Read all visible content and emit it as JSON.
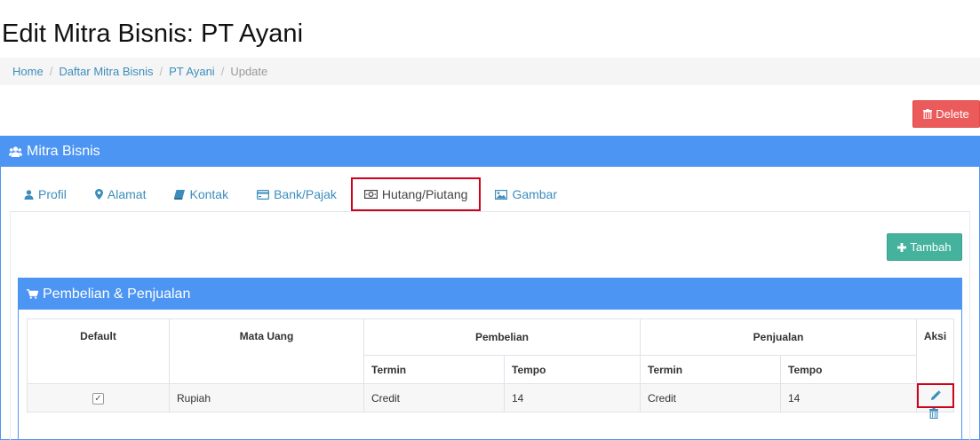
{
  "page": {
    "title": "Edit Mitra Bisnis: PT Ayani"
  },
  "breadcrumb": {
    "home": "Home",
    "list": "Daftar Mitra Bisnis",
    "item": "PT Ayani",
    "current": "Update",
    "separator": "/"
  },
  "actions": {
    "delete_label": "Delete"
  },
  "panel": {
    "heading": "Mitra Bisnis",
    "tabs": [
      {
        "label": "Profil",
        "icon": "user-icon"
      },
      {
        "label": "Alamat",
        "icon": "map-marker-icon"
      },
      {
        "label": "Kontak",
        "icon": "book-icon"
      },
      {
        "label": "Bank/Pajak",
        "icon": "credit-card-icon"
      },
      {
        "label": "Hutang/Piutang",
        "icon": "money-icon",
        "active": true
      },
      {
        "label": "Gambar",
        "icon": "picture-icon"
      }
    ]
  },
  "section": {
    "add_label": "Tambah",
    "heading": "Pembelian & Penjualan",
    "table": {
      "headers": {
        "default": "Default",
        "mata_uang": "Mata Uang",
        "pembelian": "Pembelian",
        "penjualan": "Penjualan",
        "aksi": "Aksi"
      },
      "subheaders": {
        "termin": "Termin",
        "tempo": "Tempo"
      },
      "rows": [
        {
          "default": true,
          "mata_uang": "Rupiah",
          "pembelian_termin": "Credit",
          "pembelian_tempo": "14",
          "penjualan_termin": "Credit",
          "penjualan_tempo": "14"
        }
      ]
    }
  },
  "colors": {
    "primary": "#4d95f2",
    "danger": "#ec5b5b",
    "success": "#45b29d",
    "link": "#3c8dbc",
    "highlight": "#d0021b"
  }
}
